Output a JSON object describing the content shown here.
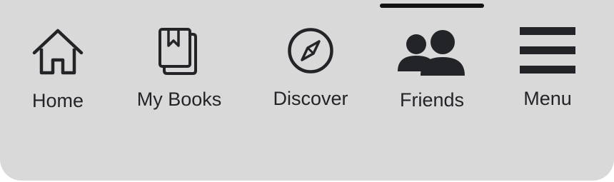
{
  "tabbar": {
    "active_tab": "Friends",
    "tabs": [
      {
        "label": "Home",
        "icon": "house-icon"
      },
      {
        "label": "My Books",
        "icon": "books-icon"
      },
      {
        "label": "Discover",
        "icon": "compass-icon"
      },
      {
        "label": "Friends",
        "icon": "people-icon"
      },
      {
        "label": "Menu",
        "icon": "hamburger-menu-icon"
      }
    ]
  },
  "colors": {
    "background": "#d9d9d9",
    "icon_and_text": "#222428",
    "active_indicator": "#111214"
  }
}
